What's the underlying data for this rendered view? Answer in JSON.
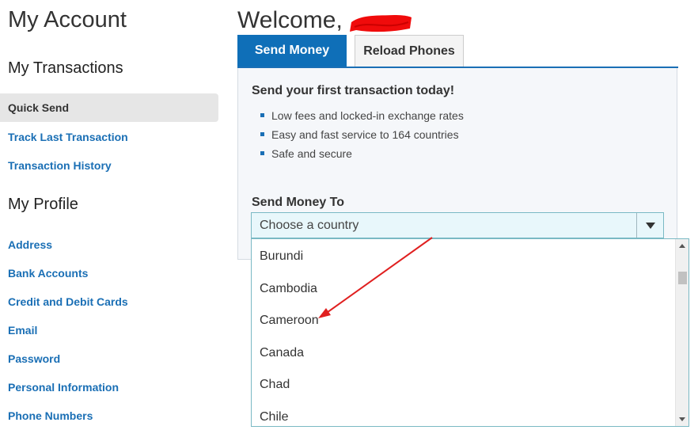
{
  "sidebar": {
    "title": "My Account",
    "transactions_heading": "My Transactions",
    "transactions": [
      {
        "label": "Quick Send"
      },
      {
        "label": "Track Last Transaction"
      },
      {
        "label": "Transaction History"
      }
    ],
    "profile_heading": "My Profile",
    "profile": [
      {
        "label": "Address"
      },
      {
        "label": "Bank Accounts"
      },
      {
        "label": "Credit and Debit Cards"
      },
      {
        "label": "Email"
      },
      {
        "label": "Password"
      },
      {
        "label": "Personal Information"
      },
      {
        "label": "Phone Numbers"
      }
    ]
  },
  "main": {
    "welcome": "Welcome,",
    "tabs": [
      {
        "label": "Send Money",
        "active": true
      },
      {
        "label": "Reload Phones",
        "active": false
      }
    ],
    "panel": {
      "heading": "Send your first transaction today!",
      "bullets": [
        "Low fees and locked-in exchange rates",
        "Easy and fast service to 164 countries",
        "Safe and secure"
      ],
      "send_to_label": "Send Money To",
      "select_placeholder": "Choose a country",
      "options": [
        "Burundi",
        "Cambodia",
        "Cameroon",
        "Canada",
        "Chad",
        "Chile"
      ]
    }
  },
  "colors": {
    "accent": "#0f6fb8",
    "link": "#1a6fb5",
    "annotation": "#e02020"
  }
}
